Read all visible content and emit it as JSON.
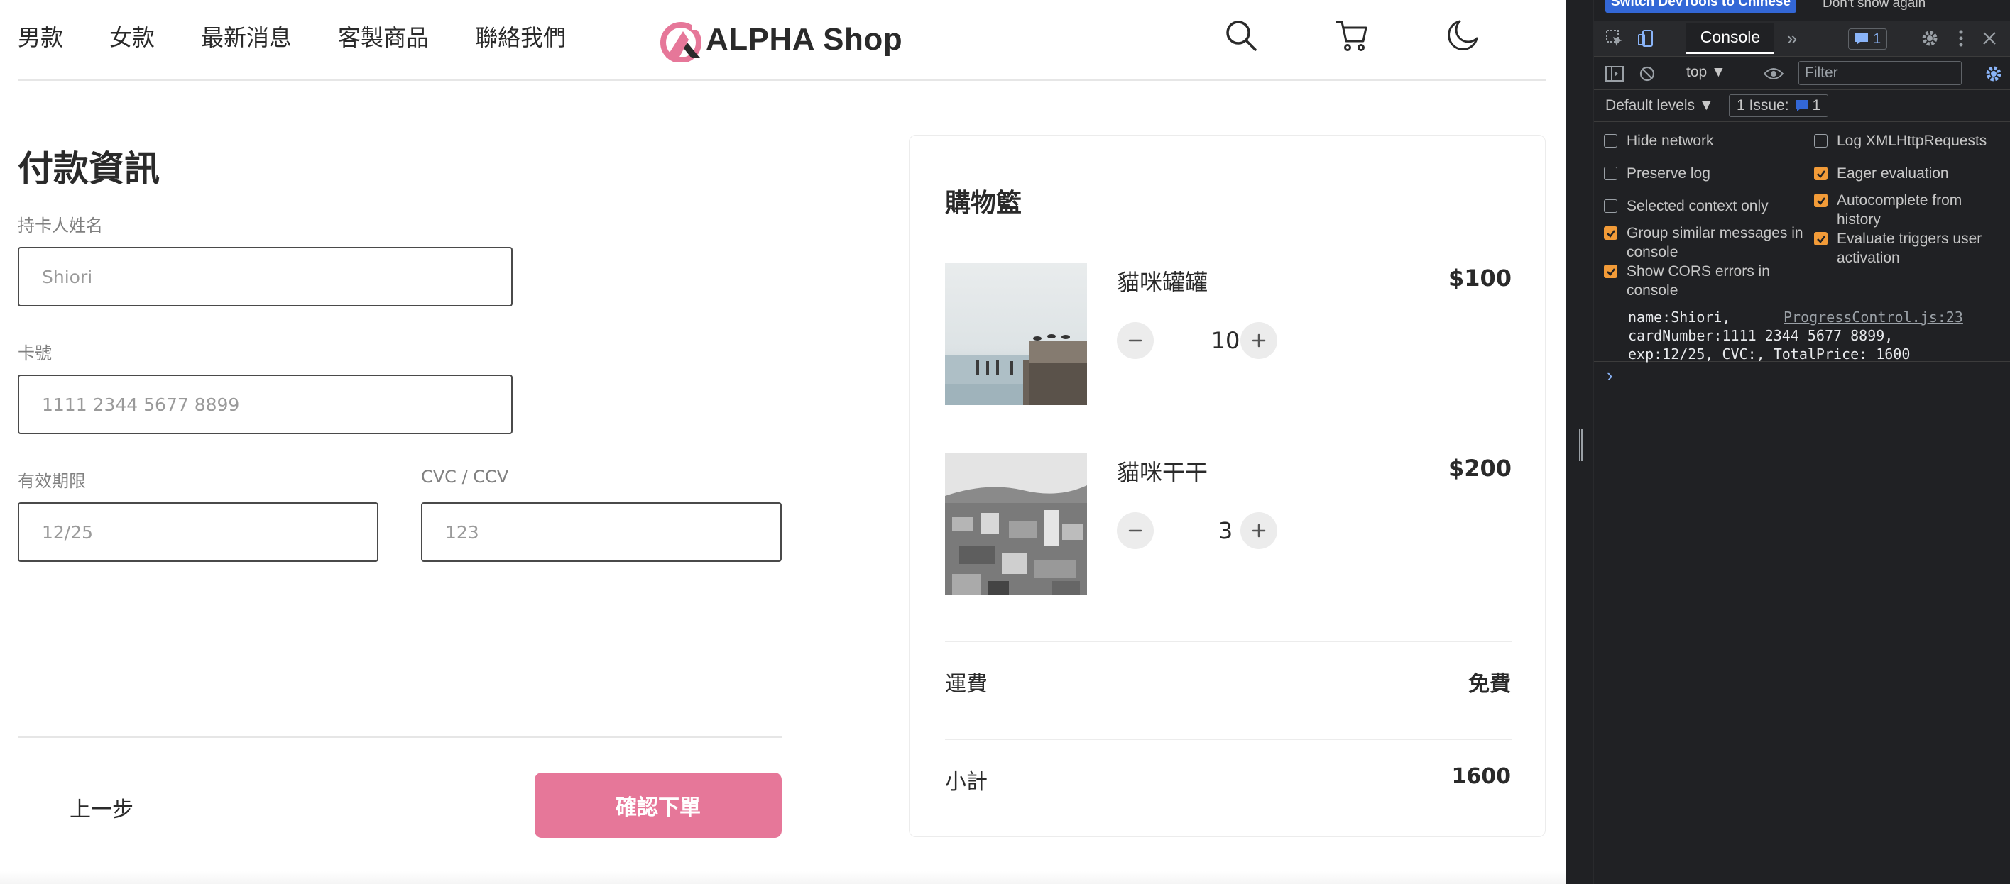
{
  "nav": {
    "links": [
      "男款",
      "女款",
      "最新消息",
      "客製商品",
      "聯絡我們"
    ],
    "brand": "ALPHA Shop",
    "icons": [
      "search-icon",
      "cart-icon",
      "moon-icon"
    ]
  },
  "form": {
    "title": "付款資訊",
    "fields": {
      "cardholder": {
        "label": "持卡人姓名",
        "placeholder": "Shiori"
      },
      "card_number": {
        "label": "卡號",
        "placeholder": "1111 2344 5677 8899"
      },
      "expiry": {
        "label": "有效期限",
        "placeholder": "12/25"
      },
      "cvc": {
        "label": "CVC / CCV",
        "placeholder": "123"
      }
    },
    "prev_label": "上一步",
    "confirm_label": "確認下單"
  },
  "cart": {
    "title": "購物籃",
    "items": [
      {
        "name": "貓咪罐罐",
        "price": "$100",
        "quantity": "10"
      },
      {
        "name": "貓咪干干",
        "price": "$200",
        "quantity": "3"
      }
    ],
    "shipping_label": "運費",
    "shipping_value": "免費",
    "subtotal_label": "小計",
    "subtotal_value": "1600"
  },
  "colors": {
    "brand_pink": "#e67799",
    "devtools_checkbox": "#f29b38",
    "devtools_blue": "#3367d6"
  },
  "devtools": {
    "banner": {
      "switch_label": "Switch DevTools to Chinese",
      "dismiss_label": "Don't show again"
    },
    "console_tab": "Console",
    "more_tabs": "»",
    "issue_count": "1",
    "context": "top ▼",
    "filter_placeholder": "Filter",
    "levels": "Default levels ▼",
    "issues_label": "1 Issue:",
    "issues_count": "1",
    "settings": [
      {
        "label": "Hide network",
        "checked": false
      },
      {
        "label": "Log XMLHttpRequests",
        "checked": false
      },
      {
        "label": "Preserve log",
        "checked": false
      },
      {
        "label": "Eager evaluation",
        "checked": true
      },
      {
        "label": "Selected context only",
        "checked": false
      },
      {
        "label": "Autocomplete from history",
        "checked": true
      },
      {
        "label": "Group similar messages in console",
        "checked": true
      },
      {
        "label": "Evaluate triggers user activation",
        "checked": true
      },
      {
        "label": "Show CORS errors in console",
        "checked": true
      }
    ],
    "log": {
      "lines": [
        "name:Shiori,",
        "cardNumber:1111 2344 5677 8899,",
        "exp:12/25, CVC:, TotalPrice: 1600"
      ],
      "source": "ProgressControl.js:23"
    },
    "prompt": "›"
  }
}
